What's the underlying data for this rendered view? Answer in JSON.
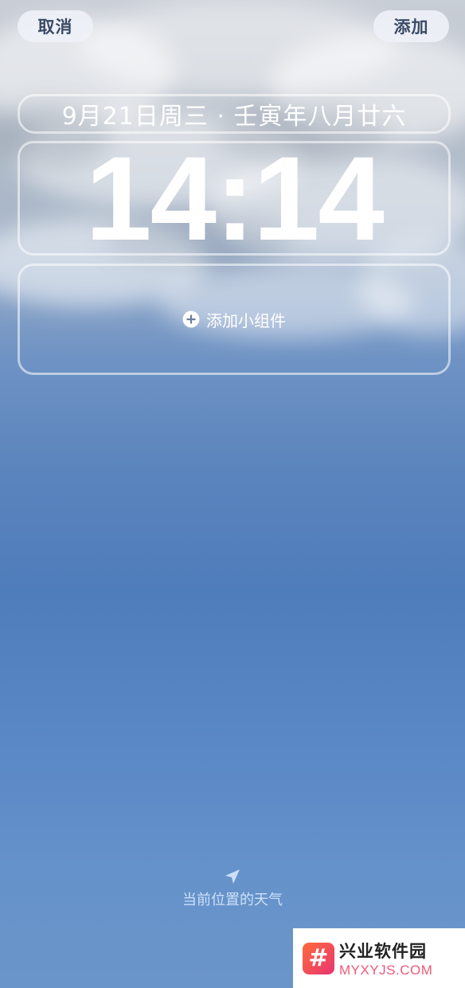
{
  "top_bar": {
    "cancel_label": "取消",
    "add_label": "添加"
  },
  "lockscreen": {
    "date_line": "9月21日周三 · 壬寅年八月廿六",
    "time": "14:14",
    "widget_label": "添加小组件"
  },
  "weather": {
    "label": "当前位置的天气",
    "icon": "location-arrow-icon"
  },
  "watermark": {
    "logo_glyph": "#",
    "name": "兴业软件园",
    "url": "MYXYJS.COM"
  },
  "colors": {
    "sky_top": "#c9ced6",
    "sky_bottom": "#6a95ca",
    "button_bg": "#eef1f7",
    "button_text": "#3a4a66",
    "watermark_accent": "#ee5a7a"
  }
}
